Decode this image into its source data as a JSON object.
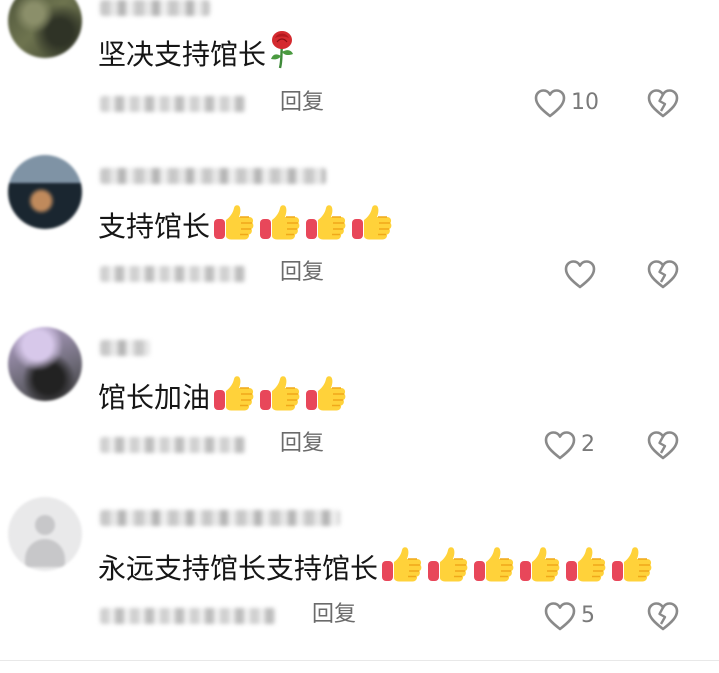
{
  "comments": [
    {
      "username": "▒▒▒ ▒▒",
      "text": "坚决支持馆长",
      "emoji": "rose-icon",
      "meta": "▒▒▒▒▒ ▒▒",
      "reply": "回复",
      "likes": "10"
    },
    {
      "username": "▒▒▒▒▒▒▒ ▒▒▒",
      "text": "支持馆长",
      "emoji": "thumbs-up-icon",
      "emoji_count": 4,
      "meta": "▒▒▒ ▒▒▒",
      "reply": "回复",
      "likes": ""
    },
    {
      "username": "▒▒▒",
      "text": "馆长加油",
      "emoji": "thumbs-up-icon",
      "emoji_count": 3,
      "meta": "▒▒▒ ▒▒▒▒",
      "reply": "回复",
      "likes": "2"
    },
    {
      "username": "▒▒▒ ▒▒▒ ▒▒▒▒",
      "text": "永远支持馆长支持馆长",
      "emoji": "thumbs-up-icon",
      "emoji_count": 6,
      "meta": "▒▒▒▒ ▒▒▒▒▒",
      "reply": "回复",
      "likes": "5"
    }
  ],
  "colors": {
    "text": "#161616",
    "secondary": "#6b6b6b",
    "icon": "#8a8a8a"
  }
}
